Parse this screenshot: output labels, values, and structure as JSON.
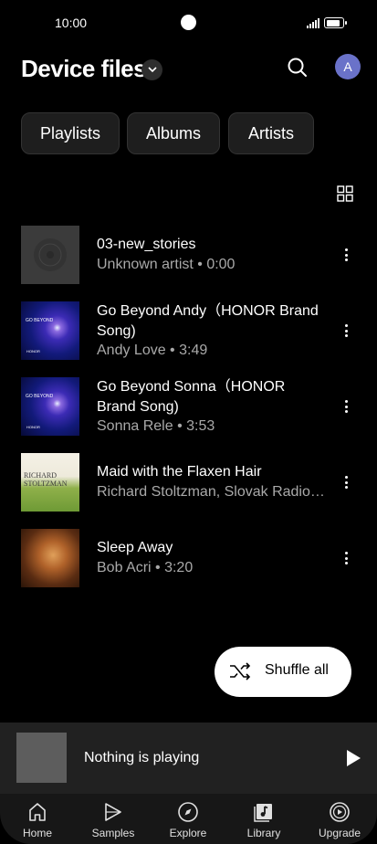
{
  "status_bar": {
    "time": "10:00"
  },
  "header": {
    "title": "Device files"
  },
  "profile": {
    "initial": "A"
  },
  "chips": [
    "Playlists",
    "Albums",
    "Artists"
  ],
  "songs": [
    {
      "title": "03-new_stories",
      "subtitle": "Unknown artist • 0:00",
      "art": "placeholder-disc"
    },
    {
      "title": "Go Beyond Andy（HONOR Brand Song)",
      "subtitle": "Andy Love • 3:49",
      "art": "go-beyond"
    },
    {
      "title": "Go Beyond Sonna（HONOR Brand Song)",
      "subtitle": "Sonna Rele • 3:53",
      "art": "go-beyond"
    },
    {
      "title": "Maid with the Flaxen Hair",
      "subtitle": "Richard Stoltzman, Slovak Radio Symphony Orchestra",
      "art": "richard-stoltzman"
    },
    {
      "title": "Sleep Away",
      "subtitle": "Bob Acri • 3:20",
      "art": "piano"
    }
  ],
  "art_text": {
    "go_beyond": "GO BEYOND",
    "honor": "HONOR",
    "richard": "RICHARD",
    "stoltzman": "STOLTZMAN"
  },
  "shuffle": {
    "label": "Shuffle all"
  },
  "player": {
    "text": "Nothing is playing"
  },
  "nav": [
    {
      "label": "Home",
      "icon": "home-icon"
    },
    {
      "label": "Samples",
      "icon": "samples-icon"
    },
    {
      "label": "Explore",
      "icon": "compass-icon"
    },
    {
      "label": "Library",
      "icon": "library-icon"
    },
    {
      "label": "Upgrade",
      "icon": "upgrade-icon"
    }
  ],
  "colors": {
    "background": "#000000",
    "avatar": "#6a72c9",
    "player": "#212121",
    "nav": "#171717"
  }
}
